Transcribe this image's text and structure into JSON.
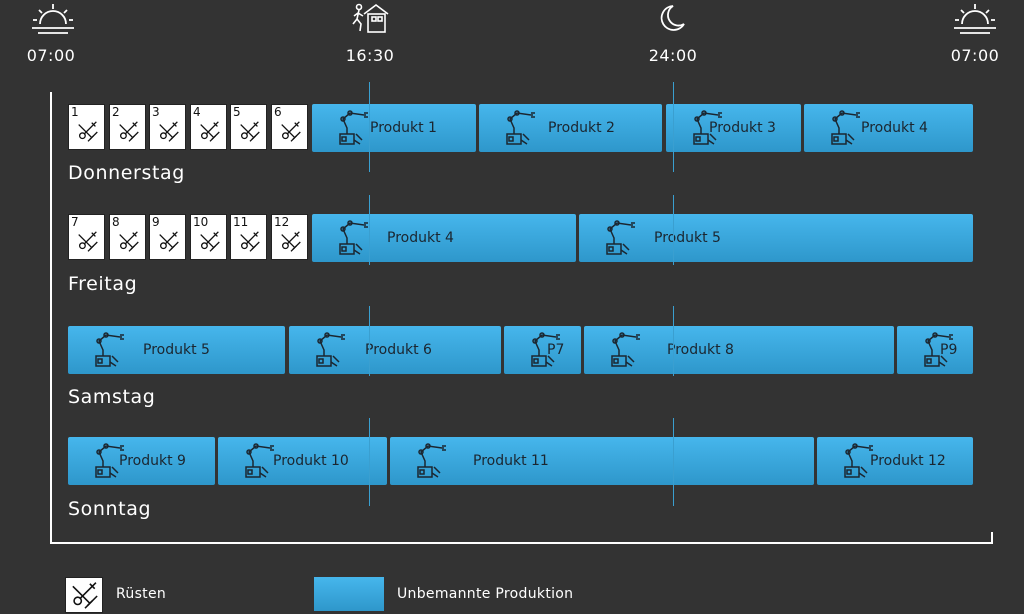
{
  "timeline": [
    {
      "label": "07:00",
      "icon": "sunrise-icon"
    },
    {
      "label": "16:30",
      "icon": "worker-leaving-icon"
    },
    {
      "label": "24:00",
      "icon": "moon-icon"
    },
    {
      "label": "07:00",
      "icon": "sunrise-icon"
    }
  ],
  "rows": [
    {
      "day": "Donnerstag",
      "setups": [
        "1",
        "2",
        "3",
        "4",
        "5",
        "6"
      ],
      "products": [
        "Produkt 1",
        "Produkt 2",
        "Produkt 3",
        "Produkt 4"
      ]
    },
    {
      "day": "Freitag",
      "setups": [
        "7",
        "8",
        "9",
        "10",
        "11",
        "12"
      ],
      "products": [
        "Produkt 4",
        "Produkt 5"
      ]
    },
    {
      "day": "Samstag",
      "setups": [],
      "products": [
        "Produkt 5",
        "Produkt 6",
        "P7",
        "Produkt 8",
        "P9"
      ]
    },
    {
      "day": "Sonntag",
      "setups": [],
      "products": [
        "Produkt 9",
        "Produkt 10",
        "Produkt 11",
        "Produkt 12"
      ]
    }
  ],
  "legend": {
    "setup_label": "Rüsten",
    "production_label": "Unbemannte Produktion"
  },
  "colors": {
    "background": "#333333",
    "production": "#3aa9de",
    "setup": "#ffffff",
    "divider": "#3a9fd0"
  }
}
